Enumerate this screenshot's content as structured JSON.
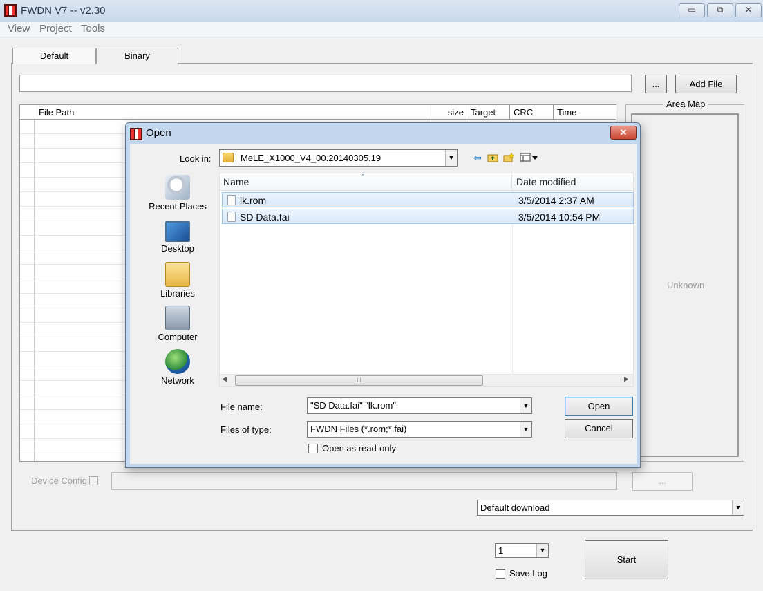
{
  "window": {
    "title": "FWDN V7 -- v2.30",
    "controls": {
      "minimize": "▭",
      "restore": "⧉",
      "close": "✕"
    }
  },
  "menu": [
    "View",
    "Project",
    "Tools"
  ],
  "tabs": [
    "Default",
    "Binary"
  ],
  "toolbar": {
    "browse_label": "...",
    "add_file_label": "Add File"
  },
  "file_table": {
    "columns": [
      "File Path",
      "size",
      "Target",
      "CRC",
      "Time"
    ]
  },
  "area_map": {
    "title": "Area Map",
    "status": "Unknown"
  },
  "device_config": {
    "label": "Device Config",
    "browse_label": "..."
  },
  "download_mode": {
    "selected": "Default download"
  },
  "count": {
    "selected": "1"
  },
  "save_log": {
    "label": "Save Log"
  },
  "start": {
    "label": "Start"
  },
  "dialog": {
    "title": "Open",
    "look_in_label": "Look in:",
    "look_in_value": "MeLE_X1000_V4_00.20140305.19",
    "places": [
      "Recent Places",
      "Desktop",
      "Libraries",
      "Computer",
      "Network"
    ],
    "columns": {
      "name": "Name",
      "date": "Date modified"
    },
    "files": [
      {
        "name": "lk.rom",
        "date": "3/5/2014 2:37 AM"
      },
      {
        "name": "SD Data.fai",
        "date": "3/5/2014 10:54 PM"
      }
    ],
    "scroll_grip": "III",
    "file_name_label": "File name:",
    "file_name_value": "\"SD Data.fai\" \"lk.rom\"",
    "file_type_label": "Files of type:",
    "file_type_value": "FWDN Files (*.rom;*.fai)",
    "read_only_label": "Open as read-only",
    "open_label": "Open",
    "cancel_label": "Cancel",
    "close_glyph": "✕"
  },
  "colors": {
    "title_bar": "#c9d8ec",
    "dialog_frame": "#c2d6ee",
    "selection": "#d8e9fb",
    "close_red": "#c84632"
  }
}
